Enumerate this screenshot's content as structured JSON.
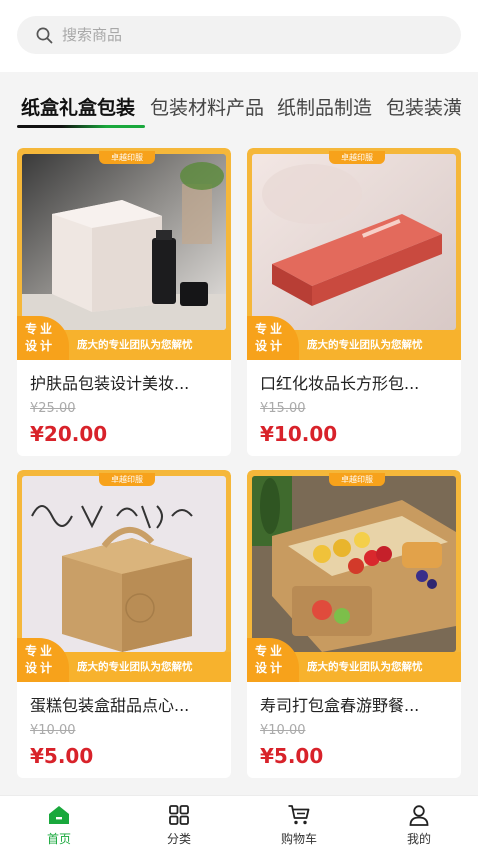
{
  "search": {
    "placeholder": "搜索商品"
  },
  "tabs": [
    {
      "label": "纸盒礼盒包装",
      "active": true
    },
    {
      "label": "包装材料产品",
      "active": false
    },
    {
      "label": "纸制品制造",
      "active": false
    },
    {
      "label": "包装装潢",
      "active": false
    }
  ],
  "colors": {
    "accent": "#19a83c",
    "price": "#d8222a",
    "badge": "#f7a21b"
  },
  "products": [
    {
      "brand_tag": "卓越印服",
      "badge_label": "专业设计",
      "badge_text": "庞大的专业团队为您解忧",
      "title": "护肤品包装设计美妆...",
      "old_price": "¥25.00",
      "price": "¥20.00"
    },
    {
      "brand_tag": "卓越印服",
      "badge_label": "专业设计",
      "badge_text": "庞大的专业团队为您解忧",
      "title": "口红化妆品长方形包...",
      "old_price": "¥15.00",
      "price": "¥10.00"
    },
    {
      "brand_tag": "卓越印服",
      "badge_label": "专业设计",
      "badge_text": "庞大的专业团队为您解忧",
      "title": "蛋糕包装盒甜品点心...",
      "old_price": "¥10.00",
      "price": "¥5.00"
    },
    {
      "brand_tag": "卓越印服",
      "badge_label": "专业设计",
      "badge_text": "庞大的专业团队为您解忧",
      "title": "寿司打包盒春游野餐...",
      "old_price": "¥10.00",
      "price": "¥5.00"
    }
  ],
  "bottom_nav": [
    {
      "label": "首页",
      "icon": "home-icon",
      "active": true
    },
    {
      "label": "分类",
      "icon": "category-icon",
      "active": false
    },
    {
      "label": "购物车",
      "icon": "cart-icon",
      "active": false
    },
    {
      "label": "我的",
      "icon": "user-icon",
      "active": false
    }
  ]
}
